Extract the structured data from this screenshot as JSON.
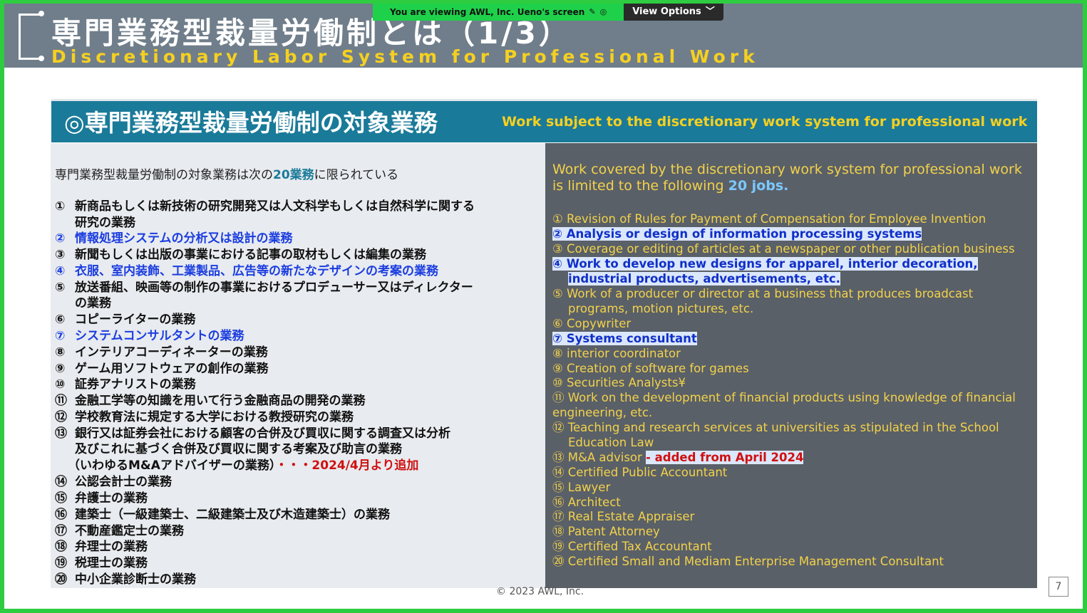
{
  "share_bar": {
    "viewing_text": "You are viewing  AWL, Inc. Ueno's screen",
    "view_options_label": "View Options"
  },
  "slide": {
    "title_jp": "専門業務型裁量労働制とは（1/3）",
    "title_en": "Discretionary Labor System for Professional Work",
    "banner_jp": "◎専門業務型裁量労働制の対象業務",
    "banner_en": "Work subject to the discretionary work system for professional work",
    "left_intro_a": "専門業務型裁量労働制の対象業務は次の",
    "left_intro_b": "20業務",
    "left_intro_c": "に限られている",
    "left_items": [
      {
        "num": "①",
        "text": "新商品もしくは新技術の研究開発又は人文科学もしくは自然科学に関する"
      },
      {
        "num": "",
        "text": "研究の業務"
      },
      {
        "num": "②",
        "text": "情報処理システムの分析又は設計の業務"
      },
      {
        "num": "③",
        "text": "新聞もしくは出版の事業における記事の取材もしくは編集の業務"
      },
      {
        "num": "④",
        "text": "衣服、室内装飾、工業製品、広告等の新たなデザインの考案の業務"
      },
      {
        "num": "⑤",
        "text": "放送番組、映画等の制作の事業におけるプロデューサー又はディレクター"
      },
      {
        "num": "",
        "text": "の業務"
      },
      {
        "num": "⑥",
        "text": "コピーライターの業務"
      },
      {
        "num": "⑦",
        "text": "システムコンサルタントの業務"
      },
      {
        "num": "⑧",
        "text": "インテリアコーディネーターの業務"
      },
      {
        "num": "⑨",
        "text": "ゲーム用ソフトウェアの創作の業務"
      },
      {
        "num": "⑩",
        "text": "証券アナリストの業務"
      },
      {
        "num": "⑪",
        "text": "金融工学等の知識を用いて行う金融商品の開発の業務"
      },
      {
        "num": "⑫",
        "text": "学校教育法に規定する大学における教授研究の業務"
      },
      {
        "num": "⑬",
        "text": "銀行又は証券会社における顧客の合併及び買収に関する調査又は分析"
      },
      {
        "num": "",
        "text": "及びこれに基づく合併及び買収に関する考案及び助言の業務"
      },
      {
        "num": "",
        "text": "（いわゆるM&Aアドバイザーの業務）"
      },
      {
        "num": "⑭",
        "text": "公認会計士の業務"
      },
      {
        "num": "⑮",
        "text": "弁護士の業務"
      },
      {
        "num": "⑯",
        "text": "建築士（一級建築士、二級建築士及び木造建築士）の業務"
      },
      {
        "num": "⑰",
        "text": "不動産鑑定士の業務"
      },
      {
        "num": "⑱",
        "text": "弁理士の業務"
      },
      {
        "num": "⑲",
        "text": "税理士の業務"
      },
      {
        "num": "⑳",
        "text": "中小企業診断士の業務"
      }
    ],
    "left_added_note": "・・・2024/4月より追加",
    "right_intro_a": "Work covered by the discretionary work system for professional work is limited to the following ",
    "right_intro_b": "20 jobs.",
    "right_items": [
      {
        "text": "① Revision of Rules for Payment of Compensation for Employee Invention"
      },
      {
        "text": "② Analysis or design of information processing systems"
      },
      {
        "text": "③ Coverage or editing of articles at a newspaper or other publication business"
      },
      {
        "text": "④ Work to develop new designs for apparel, interior decoration,"
      },
      {
        "text": "industrial products, advertisements, etc."
      },
      {
        "text": "⑤ Work of a producer or director at a business that produces broadcast"
      },
      {
        "text": "programs, motion pictures, etc."
      },
      {
        "text": "⑥ Copywriter"
      },
      {
        "text": "⑦ Systems consultant"
      },
      {
        "text": "⑧ interior coordinator"
      },
      {
        "text": "⑨ Creation of software for games"
      },
      {
        "text": "⑩ Securities Analysts¥"
      },
      {
        "text": "⑪ Work on the development of financial products using knowledge of financial"
      },
      {
        "text": "engineering, etc."
      },
      {
        "text": "⑫ Teaching and research services at universities as stipulated in the School"
      },
      {
        "text": "Education Law"
      },
      {
        "text": "⑬ M&A advisor "
      },
      {
        "text": "⑭ Certified Public Accountant"
      },
      {
        "text": "⑮ Lawyer"
      },
      {
        "text": "⑯ Architect"
      },
      {
        "text": "⑰ Real Estate Appraiser"
      },
      {
        "text": "⑱ Patent Attorney"
      },
      {
        "text": "⑲ Certified Tax Accountant"
      },
      {
        "text": "⑳ Certified Small and Mediam Enterprise Management Consultant"
      }
    ],
    "right_added_note": "- added from April 2024",
    "copyright": "© 2023 AWL, Inc.",
    "page_number": "7"
  },
  "colors": {
    "frame_border": "#2ecc40",
    "header_bg": "#707e8b",
    "banner_bg": "#1a7a99",
    "accent_yellow": "#f5d020",
    "highlight_blue": "#1b3de0",
    "added_red": "#d01010"
  }
}
